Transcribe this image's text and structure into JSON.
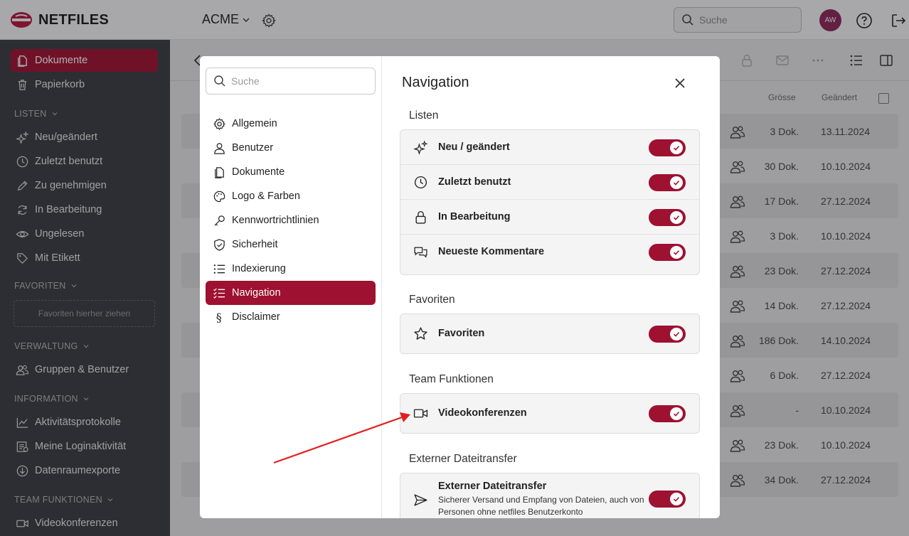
{
  "header": {
    "logo_text": "NETFILES",
    "org_name": "ACME",
    "search_placeholder": "Suche",
    "avatar_initials": "AW"
  },
  "sidebar": {
    "items": [
      {
        "label": "Dokumente",
        "icon": "document-icon"
      },
      {
        "label": "Papierkorb",
        "icon": "trash-icon"
      }
    ],
    "sections": {
      "listen": "LISTEN",
      "favoriten": "FAVORITEN",
      "verwaltung": "VERWALTUNG",
      "information": "INFORMATION",
      "team": "TEAM FUNKTIONEN"
    },
    "listen": [
      "Neu/geändert",
      "Zuletzt benutzt",
      "Zu genehmigen",
      "In Bearbeitung",
      "Ungelesen",
      "Mit Etikett"
    ],
    "favoriten_drop": "Favoriten hierher ziehen",
    "verwaltung": [
      "Gruppen & Benutzer"
    ],
    "information": [
      "Aktivitätsprotokolle",
      "Meine Loginaktivität",
      "Datenraumexporte"
    ],
    "team": [
      "Videokonferenzen"
    ]
  },
  "table": {
    "col_size": "Grösse",
    "col_changed": "Geändert",
    "rows": [
      {
        "size": "3 Dok.",
        "date": "13.11.2024"
      },
      {
        "size": "30 Dok.",
        "date": "10.10.2024"
      },
      {
        "size": "17 Dok.",
        "date": "27.12.2024"
      },
      {
        "size": "3 Dok.",
        "date": "10.10.2024"
      },
      {
        "size": "23 Dok.",
        "date": "27.12.2024"
      },
      {
        "size": "14 Dok.",
        "date": "27.12.2024"
      },
      {
        "size": "186 Dok.",
        "date": "14.10.2024"
      },
      {
        "size": "6 Dok.",
        "date": "27.12.2024"
      },
      {
        "size": "-",
        "date": "10.10.2024"
      },
      {
        "size": "23 Dok.",
        "date": "10.10.2024"
      },
      {
        "size": "34 Dok.",
        "date": "27.12.2024"
      }
    ]
  },
  "modal": {
    "search_placeholder": "Suche",
    "nav": [
      "Allgemein",
      "Benutzer",
      "Dokumente",
      "Logo & Farben",
      "Kennwortrichtlinien",
      "Sicherheit",
      "Indexierung",
      "Navigation",
      "Disclaimer"
    ],
    "title": "Navigation",
    "groups": {
      "listen": {
        "title": "Listen",
        "items": [
          "Neu / geändert",
          "Zuletzt benutzt",
          "In Bearbeitung",
          "Neueste Kommentare"
        ]
      },
      "favoriten": {
        "title": "Favoriten",
        "items": [
          "Favoriten"
        ]
      },
      "team": {
        "title": "Team Funktionen",
        "items": [
          "Videokonferenzen"
        ]
      },
      "extern": {
        "title": "Externer Dateitransfer",
        "item": "Externer Dateitransfer",
        "desc": "Sicherer Versand und Empfang von Dateien, auch von Personen ohne netfiles Benutzerkonto"
      }
    }
  },
  "colors": {
    "accent": "#9e1130",
    "sidebar_bg": "#3a3c40",
    "avatar": "#8c2757",
    "annotation_arrow": "#e02020"
  }
}
